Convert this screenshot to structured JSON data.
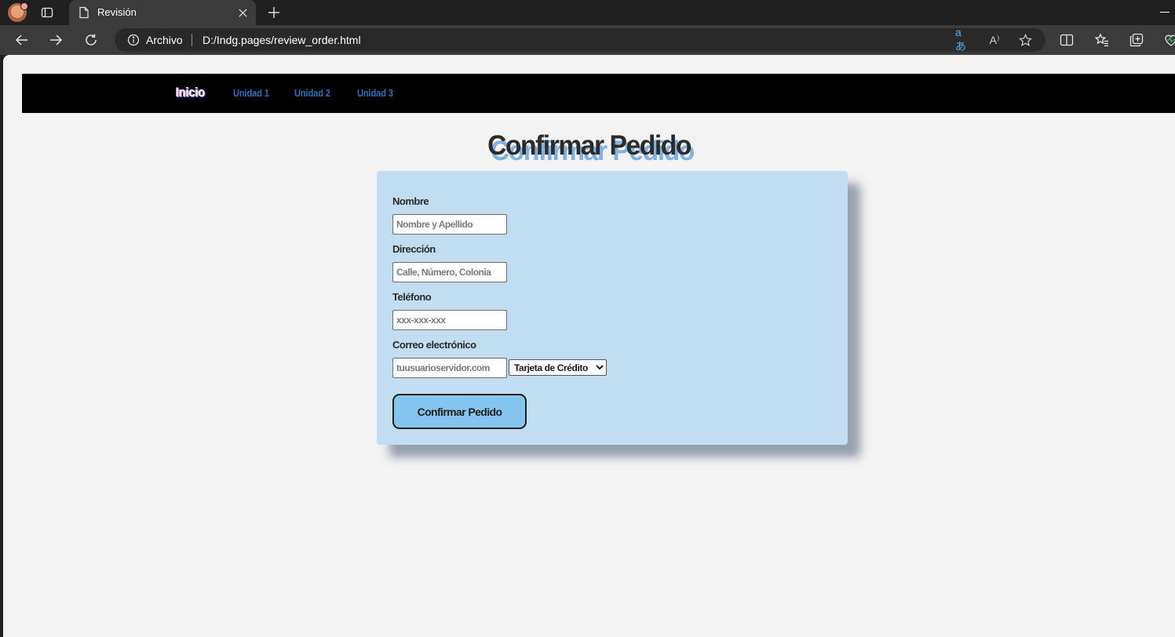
{
  "browser": {
    "tab_title": "Revisión",
    "origin_label": "Archivo",
    "url": "D:/Indg.pages/review_order.html",
    "icons": {
      "profile": "profile-avatar",
      "tab_actions": "tab-actions-icon",
      "tab_favicon": "page-icon",
      "tab_close": "close-icon",
      "new_tab": "plus-icon",
      "back": "back-arrow-icon",
      "forward": "forward-arrow-icon",
      "refresh": "refresh-icon",
      "site_info": "info-icon",
      "translate": "translate-icon",
      "read_aloud": "read-aloud-icon",
      "favorite": "star-icon",
      "split_screen": "split-screen-icon",
      "favorites": "favorites-icon",
      "collections": "collections-icon",
      "performance": "heartbeat-icon"
    },
    "translate_glyph": "aあ",
    "read_aloud_glyph": "A⁾"
  },
  "site_nav": {
    "links": [
      "Inicio",
      "Unidad 1",
      "Unidad 2",
      "Unidad 3"
    ]
  },
  "page": {
    "title": "Confirmar Pedido"
  },
  "form": {
    "name_label": "Nombre",
    "name_placeholder": "Nombre y Apellido",
    "address_label": "Dirección",
    "address_placeholder": "Calle, Número, Colonia",
    "phone_label": "Teléfono",
    "phone_placeholder": "xxx-xxx-xxx",
    "email_label": "Correo electrónico",
    "email_placeholder": "tuusuarioservidor.com",
    "payment_selected": "Tarjeta de Crédito",
    "submit_label": "Confirmar Pedido"
  },
  "colors": {
    "card_background": "#c1ddf1",
    "button_background": "#83c5ee",
    "nav_link": "#2f6fb2",
    "title_shadow": "#7fb2e0"
  }
}
